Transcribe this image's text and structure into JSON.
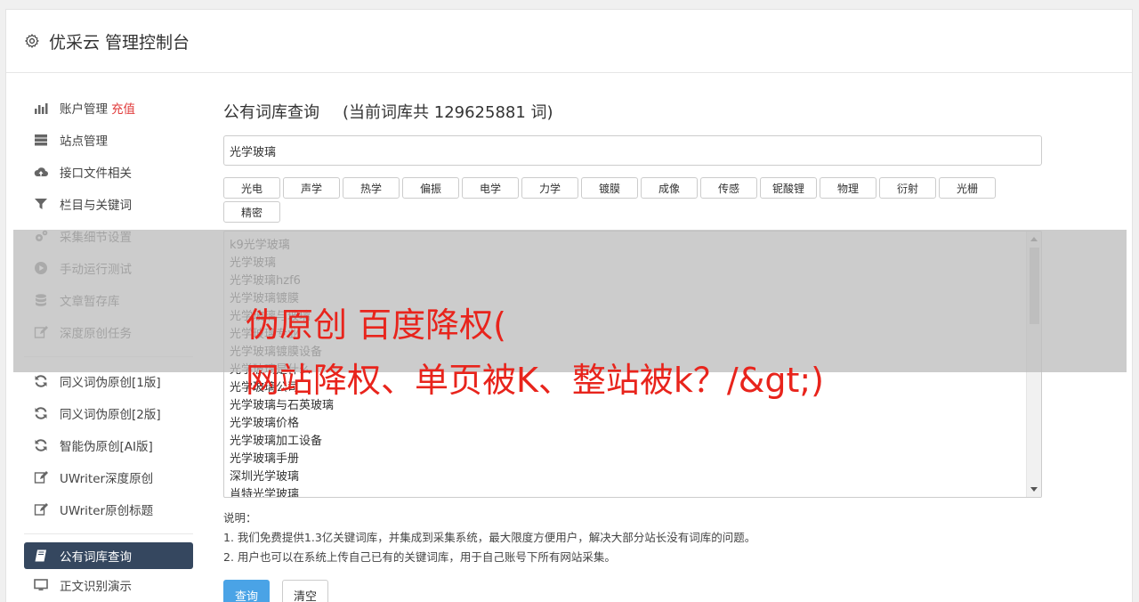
{
  "header": {
    "title": "优采云 管理控制台"
  },
  "sidebar": {
    "group1": [
      {
        "label": "账户管理",
        "highlight": "充值",
        "icon": "bar-chart-icon"
      },
      {
        "label": "站点管理",
        "icon": "server-icon"
      },
      {
        "label": "接口文件相关",
        "icon": "cloud-upload-icon"
      },
      {
        "label": "栏目与关键词",
        "icon": "filter-icon"
      },
      {
        "label": "采集细节设置",
        "icon": "gears-icon"
      },
      {
        "label": "手动运行测试",
        "icon": "play-circle-icon"
      },
      {
        "label": "文章暂存库",
        "icon": "database-icon"
      },
      {
        "label": "深度原创任务",
        "icon": "edit-icon"
      }
    ],
    "group2": [
      {
        "label": "同义词伪原创[1版]",
        "icon": "refresh-icon"
      },
      {
        "label": "同义词伪原创[2版]",
        "icon": "refresh-icon"
      },
      {
        "label": "智能伪原创[AI版]",
        "icon": "refresh-icon"
      },
      {
        "label": "UWriter深度原创",
        "icon": "edit-icon"
      },
      {
        "label": "UWriter原创标题",
        "icon": "edit-icon"
      }
    ],
    "group3": [
      {
        "label": "公有词库查询",
        "icon": "book-icon",
        "active": true
      },
      {
        "label": "正文识别演示",
        "icon": "monitor-icon"
      }
    ]
  },
  "main": {
    "title": "公有词库查询",
    "count_text": "(当前词库共 129625881 词)",
    "search_value": "光学玻璃",
    "tags": [
      "光电",
      "声学",
      "热学",
      "偏振",
      "电学",
      "力学",
      "镀膜",
      "成像",
      "传感",
      "铌酸锂",
      "物理",
      "衍射",
      "光栅",
      "精密"
    ],
    "results": [
      "k9光学玻璃",
      "光学玻璃",
      "光学玻璃hzf6",
      "光学玻璃镀膜",
      "光学玻璃与玻璃",
      "光学玻璃专业",
      "光学玻璃镀膜设备",
      "光学玻璃是什么",
      "光学玻璃公司",
      "光学玻璃与石英玻璃",
      "光学玻璃价格",
      "光学玻璃加工设备",
      "光学玻璃手册",
      "深圳光学玻璃",
      "肖特光学玻璃"
    ],
    "notes_title": "说明：",
    "notes": [
      "1. 我们免费提供1.3亿关键词库，并集成到采集系统，最大限度方便用户，解决大部分站长没有词库的问题。",
      "2. 用户也可以在系统上传自己已有的关键词库，用于自己账号下所有网站采集。"
    ],
    "query_button": "查询",
    "clear_button": "清空"
  },
  "overlay": {
    "line1": "伪原创 百度降权(",
    "line2": "网站降权、单页被K、整站被k？/&gt;)"
  },
  "colors": {
    "active_nav": "#35475f",
    "primary": "#4aa3e6",
    "highlight": "#e03a3a",
    "overlay_text": "#e8241c"
  }
}
